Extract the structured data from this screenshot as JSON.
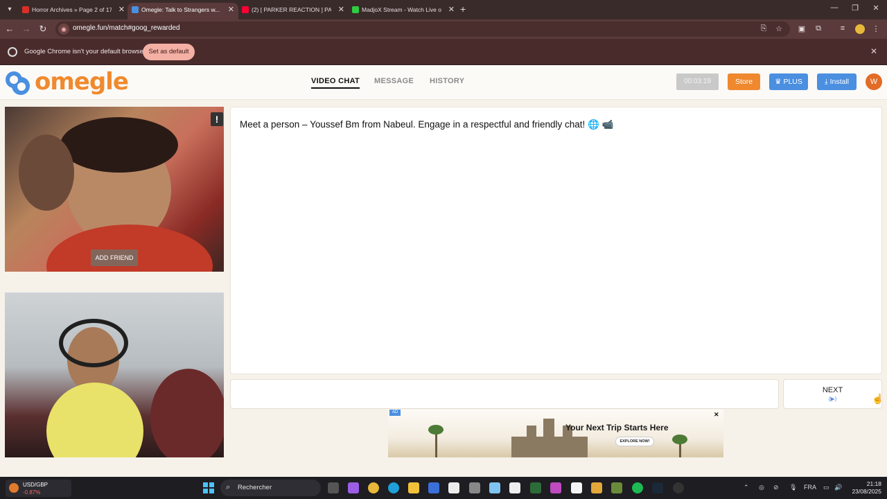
{
  "browser": {
    "tabs": [
      {
        "title": "Horror Archives » Page 2 of 17...",
        "favicon_color": "#d93025",
        "active": false
      },
      {
        "title": "Omegle: Talk to Strangers w...",
        "favicon_color": "#4a8fe0",
        "active": true
      },
      {
        "title": "(2) [ PARKER REACTION ] PART...",
        "favicon_color": "#ff0033",
        "active": false
      },
      {
        "title": "MadjoX Stream - Watch Live o...",
        "favicon_color": "#2ecc40",
        "active": false
      }
    ],
    "url": "omegle.fun/match#goog_rewarded",
    "infobar_text": "Google Chrome isn't your default browser",
    "set_default_label": "Set as default"
  },
  "site": {
    "logo_text": "omegle",
    "nav": [
      {
        "label": "VIDEO CHAT",
        "active": true
      },
      {
        "label": "MESSAGE",
        "active": false
      },
      {
        "label": "HISTORY",
        "active": false
      }
    ],
    "timer": "00:03:19",
    "store_label": "Store",
    "plus_label": "PLUS",
    "install_label": "Install",
    "avatar_initial": "W",
    "brand_color": "#f08a2e",
    "accent_color": "#4a8fe0"
  },
  "video": {
    "add_friend_label": "ADD FRIEND",
    "report_glyph": "!"
  },
  "chat": {
    "message": "Meet a person – Youssef Bm from Nabeul. Engage in a respectful and friendly chat! 🌐 📹",
    "next_label": "NEXT",
    "next_sub": "(▶)"
  },
  "ad": {
    "badge": "AD",
    "headline": "Your Next Trip Starts Here",
    "cta": "EXPLORE NOW!",
    "close": "✕"
  },
  "taskbar": {
    "ticker_name": "USD/GBP",
    "ticker_change": "-0.87%",
    "search_label": "Rechercher",
    "language": "FRA",
    "time": "21:18",
    "date": "23/08/2025"
  }
}
